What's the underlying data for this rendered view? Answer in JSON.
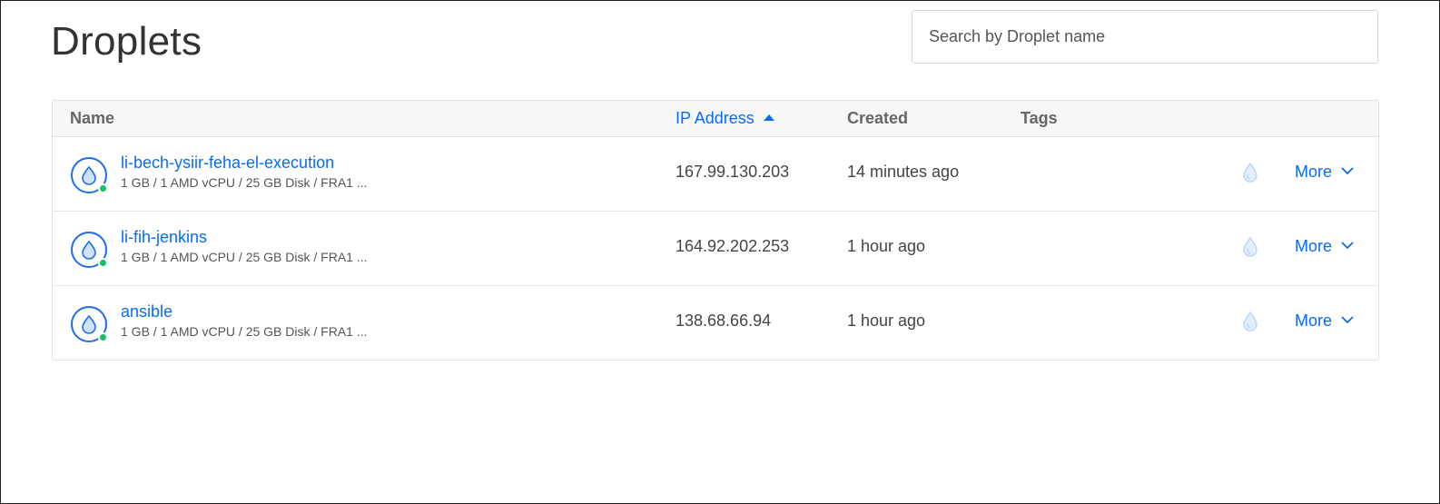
{
  "page": {
    "title": "Droplets"
  },
  "search": {
    "placeholder": "Search by Droplet name",
    "value": ""
  },
  "table": {
    "columns": {
      "name": "Name",
      "ip": "IP Address",
      "created": "Created",
      "tags": "Tags"
    },
    "sorted_column": "ip",
    "sort_direction": "ascending",
    "rows": [
      {
        "name": "li-bech-ysiir-feha-el-execution",
        "specs": "1 GB / 1 AMD vCPU / 25 GB Disk / FRA1 ...",
        "ip": "167.99.130.203",
        "created": "14 minutes ago",
        "tags": "",
        "status": "active",
        "more_label": "More"
      },
      {
        "name": "li-fih-jenkins",
        "specs": "1 GB / 1 AMD vCPU / 25 GB Disk / FRA1 ...",
        "ip": "164.92.202.253",
        "created": "1 hour ago",
        "tags": "",
        "status": "active",
        "more_label": "More"
      },
      {
        "name": "ansible",
        "specs": "1 GB / 1 AMD vCPU / 25 GB Disk / FRA1 ...",
        "ip": "138.68.66.94",
        "created": "1 hour ago",
        "tags": "",
        "status": "active",
        "more_label": "More"
      }
    ]
  },
  "icons": {
    "droplet": "droplet-icon",
    "status": "status-dot",
    "action": "droplet-action-icon",
    "chevron": "chevron-down-icon",
    "sort": "sort-ascending-icon"
  },
  "colors": {
    "link": "#0a6bf5",
    "status_active": "#15c06a",
    "icon_stroke": "#1d6ee8",
    "header_bg": "#f7f7f7"
  }
}
